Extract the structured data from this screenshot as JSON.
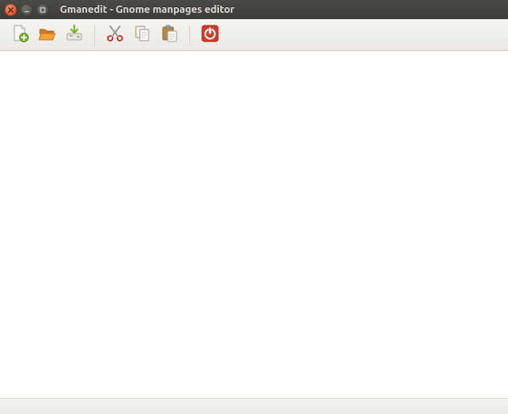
{
  "window": {
    "title": "Gmanedit - Gnome manpages editor"
  },
  "toolbar": {
    "items": [
      {
        "name": "new-file",
        "icon": "page-plus-icon"
      },
      {
        "name": "open-file",
        "icon": "folder-open-icon"
      },
      {
        "name": "save-file",
        "icon": "save-drive-icon"
      },
      {
        "name": "cut",
        "icon": "scissors-icon"
      },
      {
        "name": "copy",
        "icon": "copy-icon"
      },
      {
        "name": "paste",
        "icon": "paste-icon"
      },
      {
        "name": "quit",
        "icon": "power-icon"
      }
    ]
  },
  "editor": {
    "content": ""
  },
  "statusbar": {
    "text": ""
  }
}
